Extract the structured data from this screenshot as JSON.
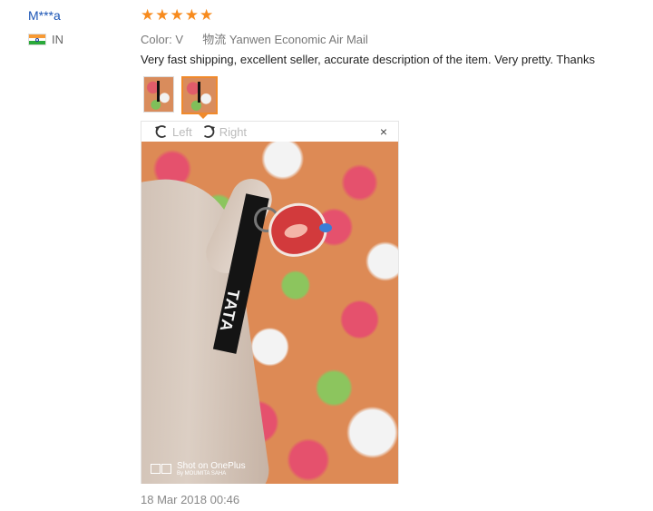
{
  "review": {
    "user": "M***a",
    "country_code": "IN",
    "stars": [
      "★",
      "★",
      "★",
      "★",
      "★"
    ],
    "color_label": "Color:",
    "color_value": "V",
    "shipping": "物流 Yanwen Economic Air Mail",
    "text": "Very fast shipping, excellent seller, accurate description of the item. Very pretty. Thanks",
    "date": "18 Mar 2018 00:46"
  },
  "viewer": {
    "rotate_left": "Left",
    "rotate_right": "Right",
    "close": "×",
    "watermark_main": "Shot on OnePlus",
    "watermark_sub": "By MOUMITA SAHA"
  },
  "colors": {
    "accent": "#f08a2c",
    "star": "#f78b1e",
    "username": "#1a54b5"
  }
}
